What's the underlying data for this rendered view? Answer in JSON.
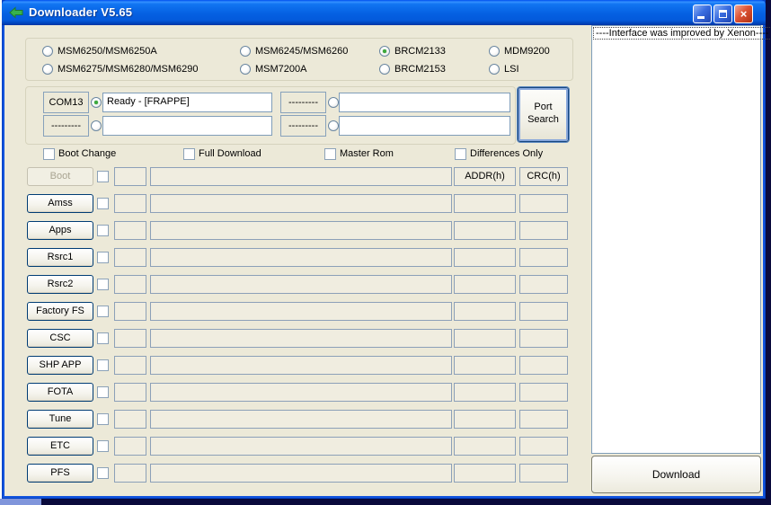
{
  "window": {
    "title": "Downloader V5.65",
    "controls": {
      "minimize": "minimize",
      "maximize": "maximize",
      "close": "×"
    }
  },
  "chipset_group": {
    "options": [
      {
        "label": "MSM6250/MSM6250A",
        "selected": false
      },
      {
        "label": "MSM6275/MSM6280/MSM6290",
        "selected": false
      },
      {
        "label": "MSM6245/MSM6260",
        "selected": false
      },
      {
        "label": "MSM7200A",
        "selected": false
      },
      {
        "label": "BRCM2133",
        "selected": true
      },
      {
        "label": "BRCM2153",
        "selected": false
      },
      {
        "label": "MDM9200",
        "selected": false
      },
      {
        "label": "LSI",
        "selected": false
      }
    ]
  },
  "ports": {
    "slots": [
      {
        "button": "COM13",
        "selected": true,
        "status": "Ready - [FRAPPE]"
      },
      {
        "button": "---------",
        "selected": false,
        "status": ""
      },
      {
        "button": "---------",
        "selected": false,
        "status": ""
      },
      {
        "button": "---------",
        "selected": false,
        "status": ""
      }
    ],
    "port_search_label": "Port Search"
  },
  "options": {
    "checkboxes": [
      {
        "label": "Boot Change",
        "checked": false
      },
      {
        "label": "Full Download",
        "checked": false
      },
      {
        "label": "Master Rom",
        "checked": false
      },
      {
        "label": "Differences Only",
        "checked": false
      }
    ]
  },
  "rows": {
    "addr_header": "ADDR(h)",
    "crc_header": "CRC(h)",
    "items": [
      {
        "label": "Boot",
        "disabled": true,
        "checked": false,
        "addr": "",
        "crc": "",
        "file": ""
      },
      {
        "label": "Amss",
        "disabled": false,
        "checked": false,
        "addr": "",
        "crc": "",
        "file": ""
      },
      {
        "label": "Apps",
        "disabled": false,
        "checked": false,
        "addr": "",
        "crc": "",
        "file": ""
      },
      {
        "label": "Rsrc1",
        "disabled": false,
        "checked": false,
        "addr": "",
        "crc": "",
        "file": ""
      },
      {
        "label": "Rsrc2",
        "disabled": false,
        "checked": false,
        "addr": "",
        "crc": "",
        "file": ""
      },
      {
        "label": "Factory FS",
        "disabled": false,
        "checked": false,
        "addr": "",
        "crc": "",
        "file": ""
      },
      {
        "label": "CSC",
        "disabled": false,
        "checked": false,
        "addr": "",
        "crc": "",
        "file": ""
      },
      {
        "label": "SHP APP",
        "disabled": false,
        "checked": false,
        "addr": "",
        "crc": "",
        "file": ""
      },
      {
        "label": "FOTA",
        "disabled": false,
        "checked": false,
        "addr": "",
        "crc": "",
        "file": ""
      },
      {
        "label": "Tune",
        "disabled": false,
        "checked": false,
        "addr": "",
        "crc": "",
        "file": ""
      },
      {
        "label": "ETC",
        "disabled": false,
        "checked": false,
        "addr": "",
        "crc": "",
        "file": ""
      },
      {
        "label": "PFS",
        "disabled": false,
        "checked": false,
        "addr": "",
        "crc": "",
        "file": ""
      }
    ]
  },
  "right_panel": {
    "log_first_line": "----Interface was improved by Xenon----",
    "download_label": "Download"
  },
  "colors": {
    "dialog_bg": "#ece9d8",
    "titlebar_blue": "#0560e2",
    "field_border": "#7f9db9",
    "selected_radio_green": "#3daa3d",
    "close_red": "#dd5335"
  }
}
